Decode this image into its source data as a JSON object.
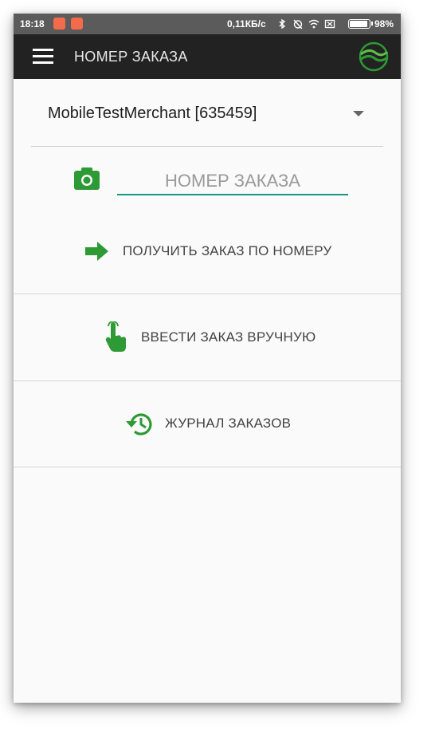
{
  "status_bar": {
    "time": "18:18",
    "speed": "0,11КБ/с",
    "battery_percent": "98%",
    "icons": [
      "notification-app-icon",
      "notification-app-icon",
      "bluetooth-icon",
      "alarm-off-icon",
      "wifi-icon",
      "sim-off-icon",
      "battery-icon"
    ]
  },
  "toolbar": {
    "title": "НОМЕР ЗАКАЗА",
    "menu_icon": "hamburger-menu-icon",
    "logo_icon": "brand-logo-icon"
  },
  "merchant": {
    "selected": "MobileTestMerchant [635459]"
  },
  "order_input": {
    "placeholder": "НОМЕР ЗАКАЗА",
    "value": "",
    "camera_icon": "camera-icon"
  },
  "actions": [
    {
      "label": "ПОЛУЧИТЬ ЗАКАЗ ПО НОМЕРУ",
      "icon": "arrow-right-icon"
    },
    {
      "label": "ВВЕСТИ ЗАКАЗ ВРУЧНУЮ",
      "icon": "hand-pointer-icon"
    },
    {
      "label": "ЖУРНАЛ ЗАКАЗОВ",
      "icon": "history-icon"
    }
  ],
  "colors": {
    "accent_green": "#2e9a36",
    "toolbar_bg": "#222222",
    "status_bar_bg": "#5b5b5b",
    "input_underline": "#159688"
  }
}
